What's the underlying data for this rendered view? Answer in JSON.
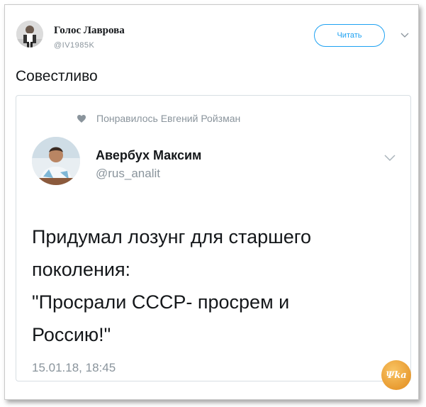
{
  "tweet": {
    "author_name": "Голос Лаврова",
    "author_handle": "@IV1985K",
    "follow_label": "Читать",
    "text": "Совестливо"
  },
  "quoted": {
    "liked_by": "Понравилось Евгений Ройзман",
    "author_name": "Авербух Максим",
    "author_handle": "@rus_analit",
    "text": "Придумал лозунг для старшего\nпоколения:\n\"Просрали СССР- просрем и\nРоссию!\"",
    "timestamp": "15.01.18, 18:45"
  },
  "watermark": {
    "text": "Ψka"
  },
  "colors": {
    "accent": "#1da1f2",
    "muted": "#8a949c"
  }
}
